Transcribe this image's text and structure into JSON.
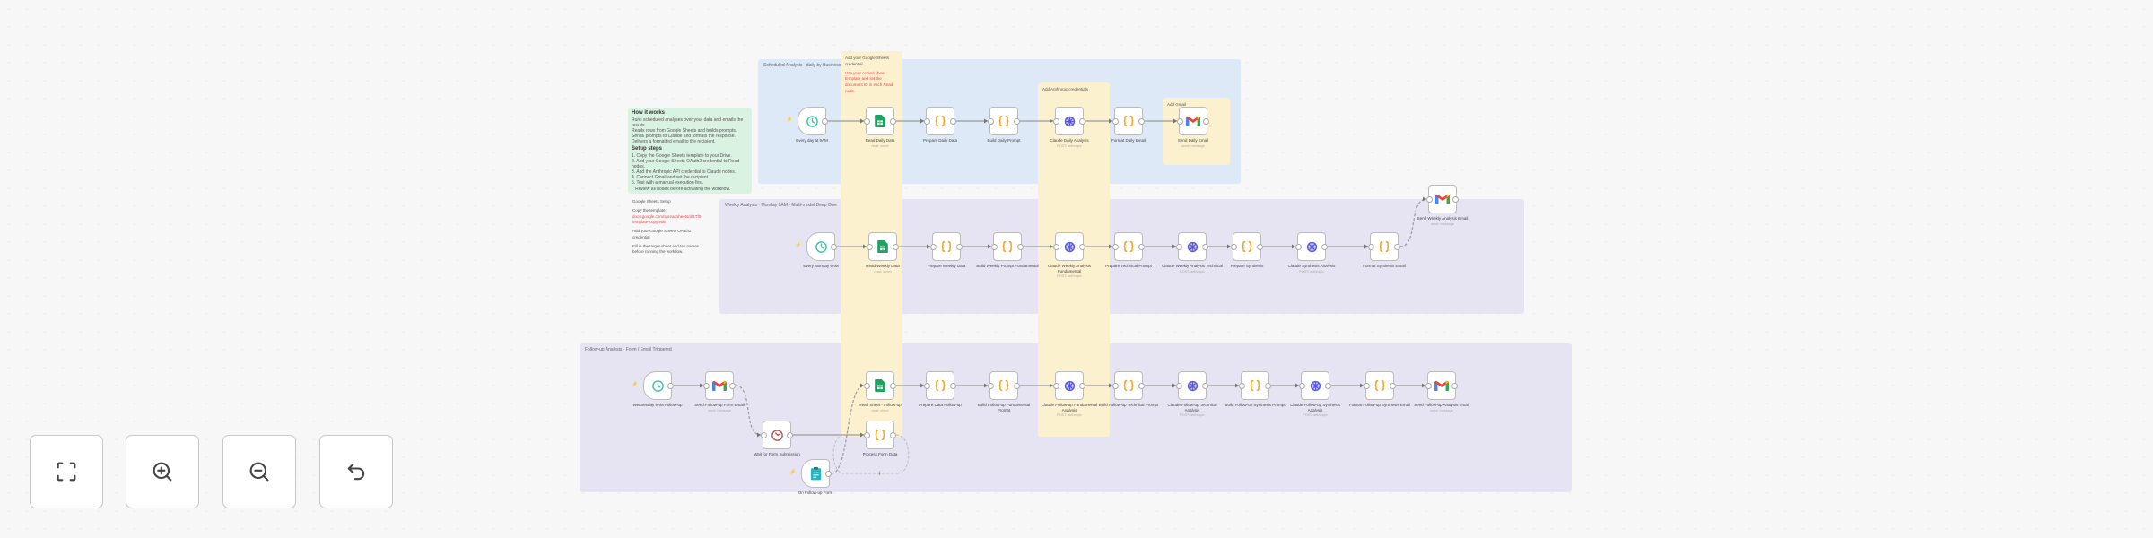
{
  "canvas": {
    "groups": [
      {
        "id": "g1",
        "title": "Scheduled Analysis · daily by Business",
        "color": "#dde9f6"
      },
      {
        "id": "g2",
        "title": "Weekly Analysis · Monday 9AM · Multi-model Deep Dive",
        "color": "#e6e3f3"
      },
      {
        "id": "g3",
        "title": "Follow-up Analysis · Form / Email Triggered",
        "color": "#e6e3f3"
      }
    ],
    "stickies": [
      {
        "id": "s_setup",
        "color": "#d9f2e2",
        "title": "How it works",
        "lines": [
          "Runs scheduled analyses over your data and emails the results.",
          "Reads rows from Google Sheets and builds prompts.",
          "Sends prompts to Claude and formats the response.",
          "Delivers a formatted email to the recipient."
        ],
        "title2": "Setup steps",
        "lines2": [
          "1. Copy the Google Sheets template to your Drive.",
          "2. Add your Google Sheets OAuth2 credential to Read nodes.",
          "3. Add the Anthropic API credential to Claude nodes.",
          "4. Connect Gmail and set the recipient.",
          "5. Test with a manual execution first."
        ],
        "note": "Review all nodes before activating the workflow."
      },
      {
        "id": "s_sheet",
        "color": "#fbf1cf",
        "title": "",
        "lines": [
          "Add your Google Sheets credential"
        ],
        "red": "Use your copied sheet template and set the document ID in each Read node."
      },
      {
        "id": "s_ai",
        "color": "#fbf1cf",
        "title": "",
        "lines": [
          "Add Anthropic credentials"
        ]
      },
      {
        "id": "s_mail",
        "color": "#fbf1cf",
        "title": "",
        "lines": [
          "Add Gmail"
        ]
      },
      {
        "id": "s_notes",
        "color": "#f7f7f7",
        "title": "",
        "lines": [
          "Google Sheets Setup"
        ],
        "label2": "Copy the template:",
        "red": "docs.google.com/spreadsheets/d/1Tf0-template-copy/edit",
        "lines2": [
          "Add your Google Sheets OAuth2 credential",
          "Fill in the target sheet and tab names before running the workflow."
        ]
      }
    ],
    "nodes": [
      {
        "id": "a1",
        "type": "trigger-clock",
        "label": "Every day at 9AM",
        "sub": ""
      },
      {
        "id": "a2",
        "type": "sheets",
        "label": "Read Daily Data",
        "sub": "read: sheet"
      },
      {
        "id": "a3",
        "type": "code",
        "label": "Prepare Daily Data",
        "sub": ""
      },
      {
        "id": "a4",
        "type": "code",
        "label": "Build Daily Prompt",
        "sub": ""
      },
      {
        "id": "a5",
        "type": "ai",
        "label": "Claude Daily Analysis",
        "sub": "POST: anthropic"
      },
      {
        "id": "a6",
        "type": "code",
        "label": "Format Daily Email",
        "sub": ""
      },
      {
        "id": "a7",
        "type": "gmail",
        "label": "Send Daily Email",
        "sub": "send: message"
      },
      {
        "id": "b1",
        "type": "trigger-clock",
        "label": "Every Monday 9AM",
        "sub": ""
      },
      {
        "id": "b2",
        "type": "sheets",
        "label": "Read Weekly Data",
        "sub": "read: sheet"
      },
      {
        "id": "b3",
        "type": "code",
        "label": "Prepare Weekly Data",
        "sub": ""
      },
      {
        "id": "b4",
        "type": "code",
        "label": "Build Weekly Prompt Fundamental",
        "sub": ""
      },
      {
        "id": "b5",
        "type": "ai",
        "label": "Claude Weekly Analysis Fundamental",
        "sub": "POST: anthropic"
      },
      {
        "id": "b6",
        "type": "code",
        "label": "Prepare Technical Prompt",
        "sub": ""
      },
      {
        "id": "b7",
        "type": "ai",
        "label": "Claude Weekly Analysis Technical",
        "sub": "POST: anthropic"
      },
      {
        "id": "b8",
        "type": "code",
        "label": "Prepare Synthesis",
        "sub": ""
      },
      {
        "id": "b9",
        "type": "ai",
        "label": "Claude Synthesis Analysis",
        "sub": "POST: anthropic"
      },
      {
        "id": "b10",
        "type": "code",
        "label": "Format Synthesis Email",
        "sub": ""
      },
      {
        "id": "b11",
        "type": "gmail",
        "label": "Send Weekly Analysis Email",
        "sub": "send: message"
      },
      {
        "id": "c1",
        "type": "trigger-clock",
        "label": "Wednesday 9AM Follow-up",
        "sub": ""
      },
      {
        "id": "c2",
        "type": "gmail",
        "label": "Send Follow-up Form Email",
        "sub": "send: message"
      },
      {
        "id": "c3",
        "type": "wait",
        "label": "Wait for Form Submission",
        "sub": ""
      },
      {
        "id": "c4",
        "type": "sheets",
        "label": "Read Sheet - Follow-up",
        "sub": "read: sheet"
      },
      {
        "id": "c5",
        "type": "code",
        "label": "Prepare Data Follow-up",
        "sub": ""
      },
      {
        "id": "c6",
        "type": "code",
        "label": "Build Follow-up Fundamental Prompt",
        "sub": ""
      },
      {
        "id": "c7",
        "type": "ai",
        "label": "Claude Follow-up Fundamental Analysis",
        "sub": "POST: anthropic"
      },
      {
        "id": "c8",
        "type": "code",
        "label": "Build Follow-up Technical Prompt",
        "sub": ""
      },
      {
        "id": "c9",
        "type": "ai",
        "label": "Claude Follow-up Technical Analysis",
        "sub": "POST: anthropic"
      },
      {
        "id": "c10",
        "type": "code",
        "label": "Build Follow-up Synthesis Prompt",
        "sub": ""
      },
      {
        "id": "c11",
        "type": "ai",
        "label": "Claude Follow-up Synthesis Analysis",
        "sub": "POST: anthropic"
      },
      {
        "id": "c12",
        "type": "code",
        "label": "Format Follow-up Synthesis Email",
        "sub": ""
      },
      {
        "id": "c13",
        "type": "gmail",
        "label": "Send Follow-up Analysis Email",
        "sub": "send: message"
      },
      {
        "id": "c14",
        "type": "code",
        "label": "Process Form Data",
        "sub": ""
      },
      {
        "id": "c15",
        "type": "trigger-form",
        "label": "On Follow-up Form",
        "sub": ""
      }
    ],
    "edges": [
      [
        "a1",
        "a2"
      ],
      [
        "a2",
        "a3"
      ],
      [
        "a3",
        "a4"
      ],
      [
        "a4",
        "a5"
      ],
      [
        "a5",
        "a6"
      ],
      [
        "a6",
        "a7"
      ],
      [
        "b1",
        "b2"
      ],
      [
        "b2",
        "b3"
      ],
      [
        "b3",
        "b4"
      ],
      [
        "b4",
        "b5"
      ],
      [
        "b5",
        "b6"
      ],
      [
        "b6",
        "b7"
      ],
      [
        "b7",
        "b8"
      ],
      [
        "b8",
        "b9"
      ],
      [
        "b9",
        "b10"
      ],
      [
        "b10",
        "b11"
      ],
      [
        "c1",
        "c2"
      ],
      [
        "c2",
        "c3"
      ],
      [
        "c3",
        "c14"
      ],
      [
        "c15",
        "c4"
      ],
      [
        "c4",
        "c5"
      ],
      [
        "c5",
        "c6"
      ],
      [
        "c6",
        "c7"
      ],
      [
        "c7",
        "c8"
      ],
      [
        "c8",
        "c9"
      ],
      [
        "c9",
        "c10"
      ],
      [
        "c10",
        "c11"
      ],
      [
        "c11",
        "c12"
      ],
      [
        "c12",
        "c13"
      ]
    ],
    "colors": {
      "code": "#f59e0b",
      "sheets": "#1ea362",
      "ai": "#5b5bd6",
      "clock": "#3cc4a0",
      "wait": "#b5524f",
      "form": "#27b5c4"
    }
  },
  "controls": [
    {
      "name": "fit-view-button",
      "icon": "fit-view-icon"
    },
    {
      "name": "zoom-in-button",
      "icon": "zoom-in-icon"
    },
    {
      "name": "zoom-out-button",
      "icon": "zoom-out-icon"
    },
    {
      "name": "reset-zoom-button",
      "icon": "undo-icon"
    }
  ]
}
